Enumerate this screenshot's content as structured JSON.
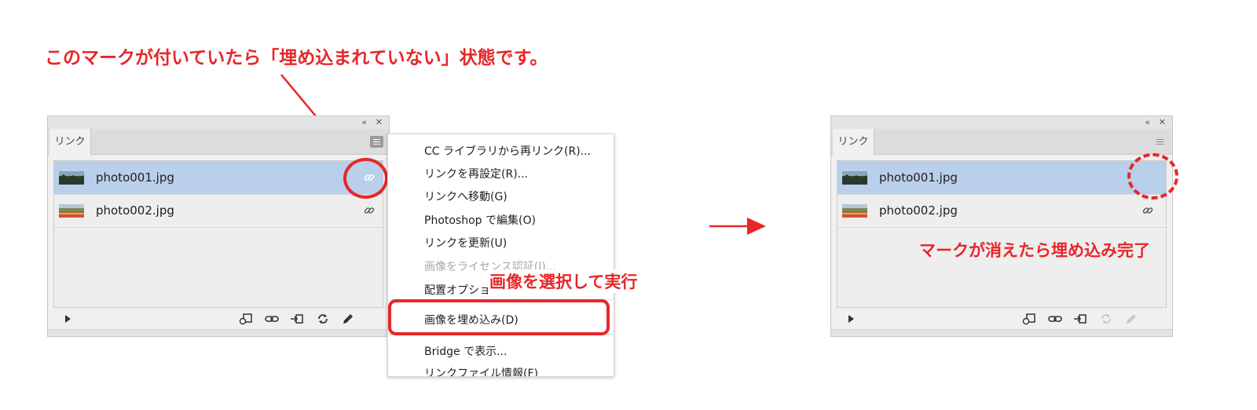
{
  "annotations": {
    "headline": "このマークが付いていたら「埋め込まれていない」状態です。",
    "select_instruction": "画像を選択して実行",
    "complete_note": "マークが消えたら埋め込み完了",
    "accent_color": "#e8262a"
  },
  "panel_before": {
    "collapse_icon": "«",
    "close_icon": "✕",
    "tab_label": "リンク",
    "files": [
      {
        "name": "photo001.jpg",
        "selected": true,
        "link_icon": "link-icon"
      },
      {
        "name": "photo002.jpg",
        "selected": false,
        "link_icon": "link-icon"
      }
    ],
    "toolbar_icons": [
      "play-icon",
      "relink-library-icon",
      "relink-icon",
      "goto-link-icon",
      "update-link-icon",
      "edit-original-icon"
    ]
  },
  "context_menu": {
    "items": [
      {
        "label": "CC ライブラリから再リンク(R)...",
        "enabled": true
      },
      {
        "label": "リンクを再設定(R)...",
        "enabled": true
      },
      {
        "label": "リンクへ移動(G)",
        "enabled": true
      },
      {
        "label": "Photoshop で編集(O)",
        "enabled": true
      },
      {
        "label": "リンクを更新(U)",
        "enabled": true
      },
      {
        "label": "画像をライセンス認証(I)...",
        "enabled": false
      },
      {
        "label": "配置オプショ",
        "enabled": true
      },
      {
        "label": "画像を埋め込み(D)",
        "enabled": true,
        "highlighted": true
      },
      {
        "label": "Bridge で表示...",
        "enabled": true
      },
      {
        "label": "リンクファイル情報(F)",
        "enabled": true
      }
    ]
  },
  "panel_after": {
    "collapse_icon": "«",
    "close_icon": "✕",
    "tab_label": "リンク",
    "files": [
      {
        "name": "photo001.jpg",
        "selected": true,
        "link_icon": ""
      },
      {
        "name": "photo002.jpg",
        "selected": false,
        "link_icon": "link-icon"
      }
    ]
  }
}
